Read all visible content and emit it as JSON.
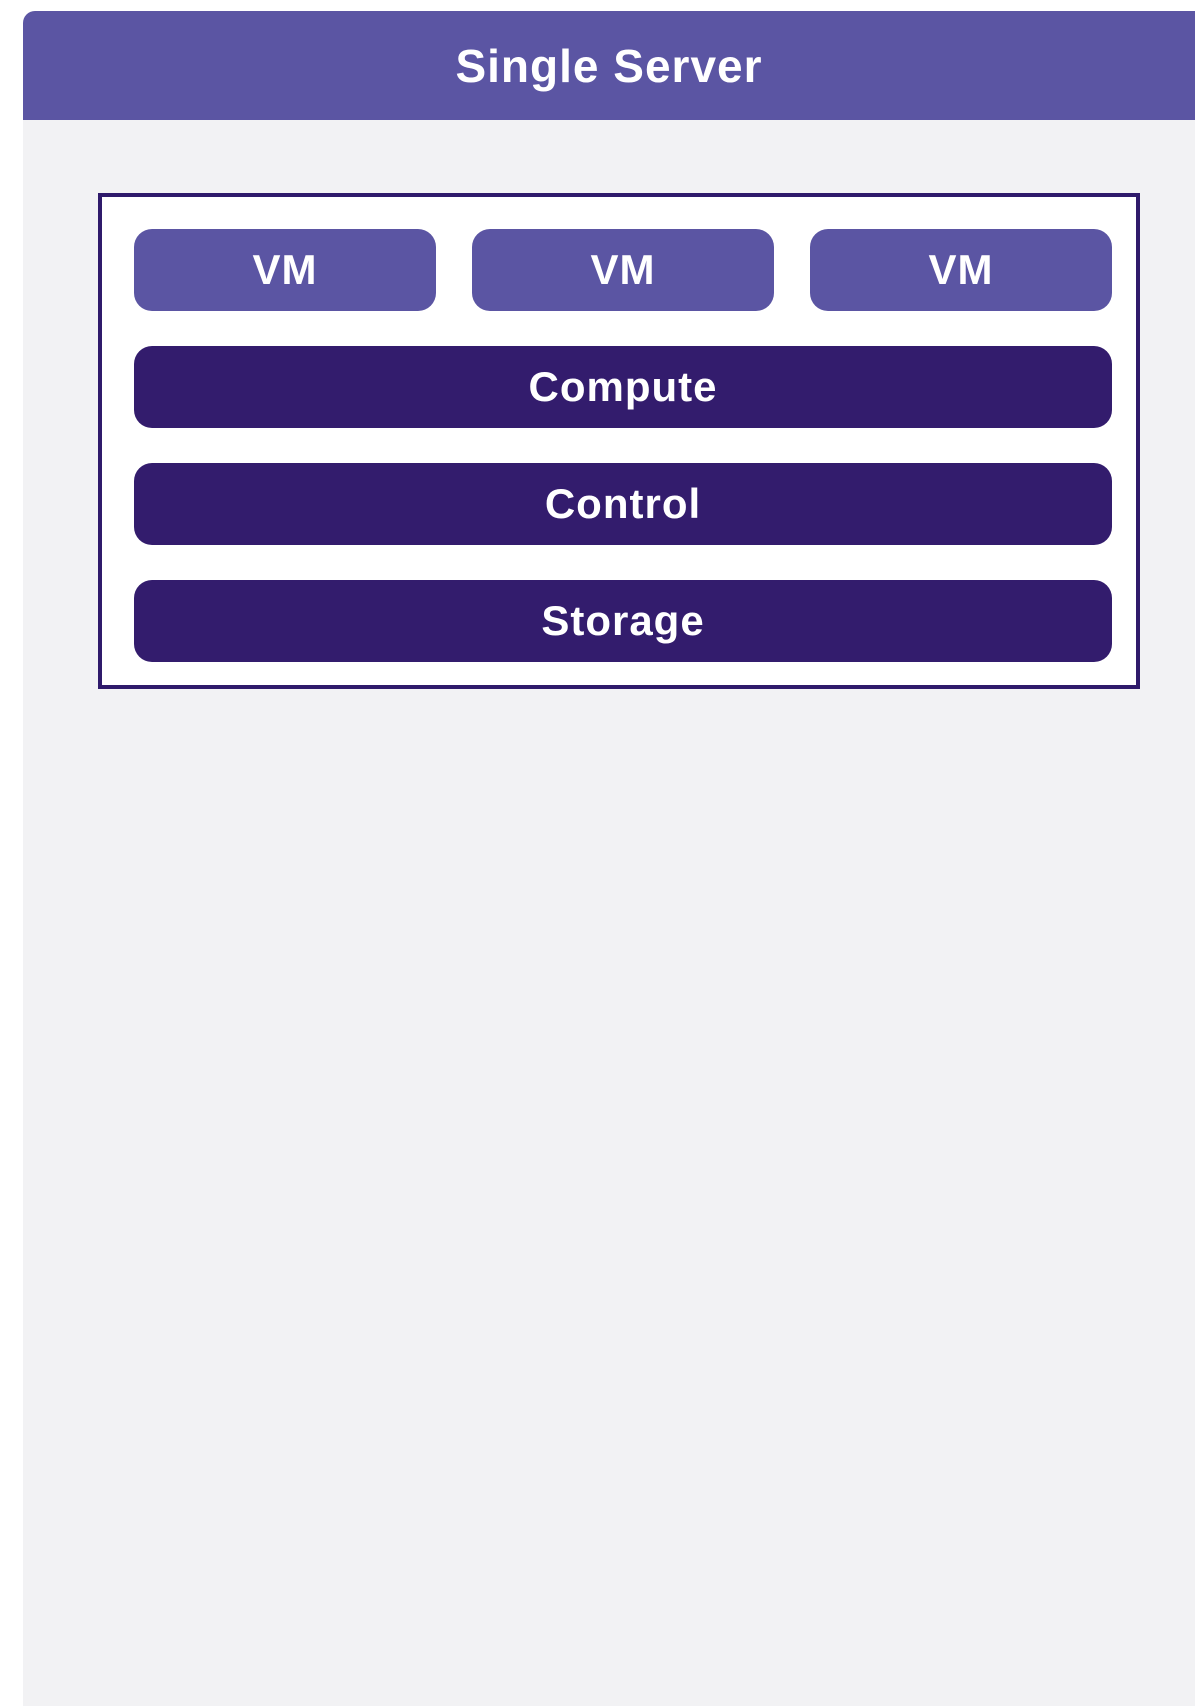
{
  "colors": {
    "header": "#5b55a3",
    "vm": "#5b55a3",
    "layer": "#331c6d",
    "panel_background": "#f2f2f4",
    "server_border": "#2f1a6b"
  },
  "panel": {
    "title": "Single Server"
  },
  "server": {
    "vms": [
      {
        "label": "VM"
      },
      {
        "label": "VM"
      },
      {
        "label": "VM"
      }
    ],
    "layers": [
      {
        "label": "Compute"
      },
      {
        "label": "Control"
      },
      {
        "label": "Storage"
      }
    ]
  }
}
